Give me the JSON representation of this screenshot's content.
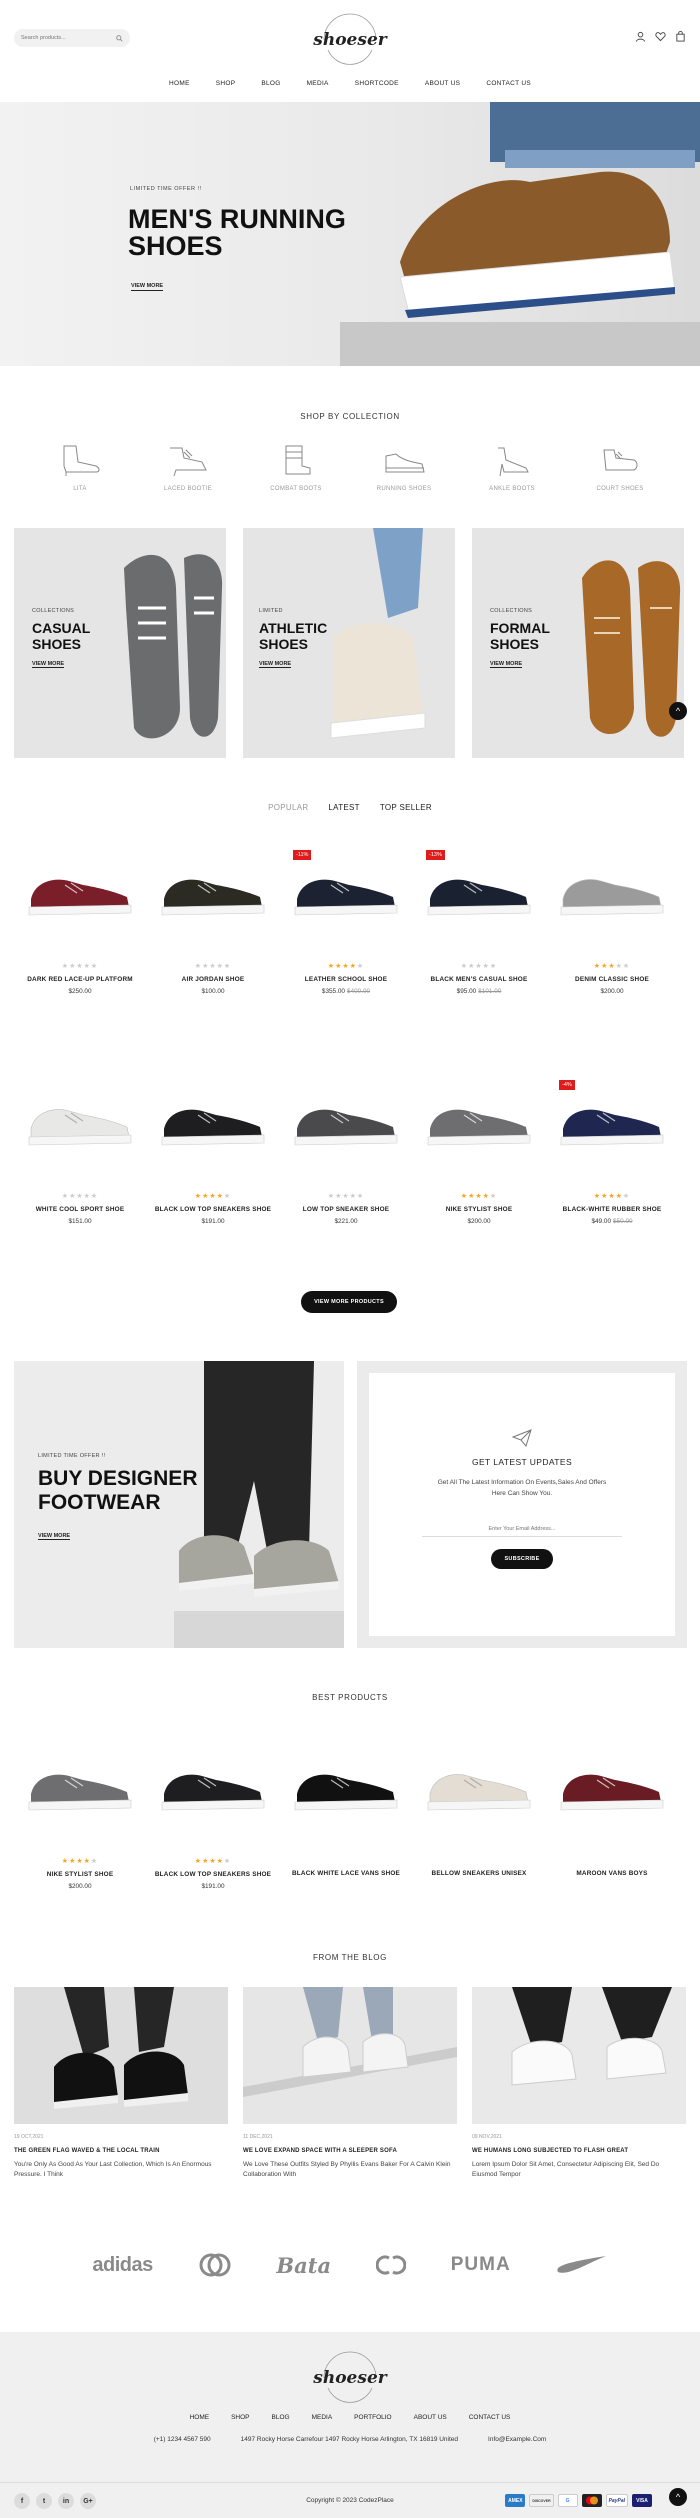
{
  "header": {
    "search_placeholder": "Search products...",
    "logo": "shoeser",
    "nav": [
      "HOME",
      "SHOP",
      "BLOG",
      "MEDIA",
      "SHORTCODE",
      "ABOUT US",
      "CONTACT US"
    ]
  },
  "hero": {
    "small": "LIMITED TIME OFFER !!",
    "title": "MEN'S RUNNING SHOES",
    "link": "VIEW MORE"
  },
  "collection": {
    "title": "SHOP BY COLLECTION",
    "items": [
      {
        "label": "LITA",
        "icon": "heel-boot-icon"
      },
      {
        "label": "LACED BOOTIE",
        "icon": "laced-bootie-icon"
      },
      {
        "label": "COMBAT BOOTS",
        "icon": "combat-boot-icon"
      },
      {
        "label": "RUNNING SHOES",
        "icon": "running-shoe-icon"
      },
      {
        "label": "ANKLE BOOTS",
        "icon": "ankle-heel-icon"
      },
      {
        "label": "COURT SHOES",
        "icon": "court-shoe-icon"
      }
    ]
  },
  "banners": [
    {
      "small": "COLLECTIONS",
      "title_1": "CASUAL",
      "title_2": "SHOES",
      "link": "VIEW MORE"
    },
    {
      "small": "LIMITED",
      "title_1": "ATHLETIC",
      "title_2": "SHOES",
      "link": "VIEW MORE"
    },
    {
      "small": "COLLECTIONS",
      "title_1": "FORMAL",
      "title_2": "SHOES",
      "link": "VIEW MORE"
    }
  ],
  "tabs": [
    "POPULAR",
    "LATEST",
    "TOP SELLER"
  ],
  "products": [
    {
      "name": "DARK RED LACE-UP PLATFORM",
      "price": "$250.00",
      "old": "",
      "stars": 0,
      "badge": "",
      "color": "#7a1e2a"
    },
    {
      "name": "AIR JORDAN SHOE",
      "price": "$100.00",
      "old": "",
      "stars": 0,
      "badge": "",
      "color": "#2b2b24"
    },
    {
      "name": "LEATHER SCHOOL SHOE",
      "price": "$355.00",
      "old": "$400.00",
      "stars": 4,
      "badge": "-11%",
      "color": "#1d2233"
    },
    {
      "name": "BLACK MEN'S CASUAL SHOE",
      "price": "$95.00",
      "old": "$101.00",
      "stars": 0,
      "badge": "-13%",
      "color": "#1a2130"
    },
    {
      "name": "DENIM CLASSIC SHOE",
      "price": "$200.00",
      "old": "",
      "stars": 3,
      "badge": "",
      "color": "#9b9b9b"
    },
    {
      "name": "WHITE COOL SPORT SHOE",
      "price": "$151.00",
      "old": "",
      "stars": 0,
      "badge": "",
      "color": "#e8e8e6"
    },
    {
      "name": "BLACK LOW TOP SNEAKERS SHOE",
      "price": "$191.00",
      "old": "",
      "stars": 4,
      "badge": "",
      "color": "#1e1e20"
    },
    {
      "name": "LOW TOP SNEAKER SHOE",
      "price": "$221.00",
      "old": "",
      "stars": 0,
      "badge": "",
      "color": "#4a4a4c"
    },
    {
      "name": "NIKE STYLIST SHOE",
      "price": "$200.00",
      "old": "",
      "stars": 4,
      "badge": "",
      "color": "#6e6e70"
    },
    {
      "name": "BLACK-WHITE RUBBER SHOE",
      "price": "$49.00",
      "old": "$50.00",
      "stars": 4,
      "badge": "-4%",
      "color": "#1f2750"
    }
  ],
  "view_more_products": "VIEW MORE PRODUCTS",
  "designer": {
    "small": "LIMITED TIME OFFER !!",
    "title_1": "BUY DESIGNER",
    "title_2": "FOOTWEAR",
    "link": "VIEW MORE"
  },
  "newsletter": {
    "title": "GET LATEST UPDATES",
    "text": "Get All The Latest Information On Events,Sales And Offers Here Can Show You.",
    "placeholder": "Enter Your Email Address...",
    "button": "SUBSCRIBE"
  },
  "best": {
    "title": "BEST PRODUCTS",
    "items": [
      {
        "name": "NIKE STYLIST SHOE",
        "price": "$200.00",
        "stars": 4,
        "color": "#6e6e70"
      },
      {
        "name": "BLACK LOW TOP SNEAKERS SHOE",
        "price": "$191.00",
        "stars": 4,
        "color": "#1e1e20"
      },
      {
        "name": "BLACK WHITE LACE VANS SHOE",
        "price": "",
        "stars": 0,
        "color": "#111"
      },
      {
        "name": "BELLOW SNEAKERS UNISEX",
        "price": "",
        "stars": 0,
        "color": "#e4ddd3"
      },
      {
        "name": "MAROON VANS BOYS",
        "price": "",
        "stars": 0,
        "color": "#6a1c24"
      }
    ]
  },
  "blog": {
    "title": "FROM THE BLOG",
    "posts": [
      {
        "date": "19 OCT,2021",
        "title": "THE GREEN FLAG WAVED & THE LOCAL TRAIN",
        "text": "You're Only As Good As Your Last Collection, Which Is An Enormous Pressure. I Think"
      },
      {
        "date": "11 DEC,2021",
        "title": "WE LOVE EXPAND SPACE WITH A SLEEPER SOFA",
        "text": "We Love These Outfits Styled By Phyllis Evans Baker For A Calvin Klein Collaboration With"
      },
      {
        "date": "09 NOV,2021",
        "title": "WE HUMANS LONG SUBJECTED TO FLASH GREAT",
        "text": "Lorem Ipsum Dolor Sit Amet, Consectetur Adipiscing Elit, Sed Do Eiusmod Tempor"
      }
    ]
  },
  "brands": [
    "adidas",
    "Gucci",
    "Bata",
    "Chanel",
    "PUMA",
    "Nike"
  ],
  "footer": {
    "logo": "shoeser",
    "nav": [
      "HOME",
      "SHOP",
      "BLOG",
      "MEDIA",
      "PORTFOLIO",
      "ABOUT US",
      "CONTACT US"
    ],
    "phone": "(+1) 1234 4567 590",
    "address": "1497 Rocky Horse Carrefour 1497 Rocky Horse Arlington, TX 16819 United",
    "email": "Info@Example.Com",
    "copyright": "Copyright © 2023 CodezPlace",
    "social": [
      "f",
      "t",
      "in",
      "G+"
    ],
    "payments": [
      "AMEX",
      "DISCOVER",
      "G",
      "MC",
      "PayPal",
      "VISA"
    ]
  }
}
